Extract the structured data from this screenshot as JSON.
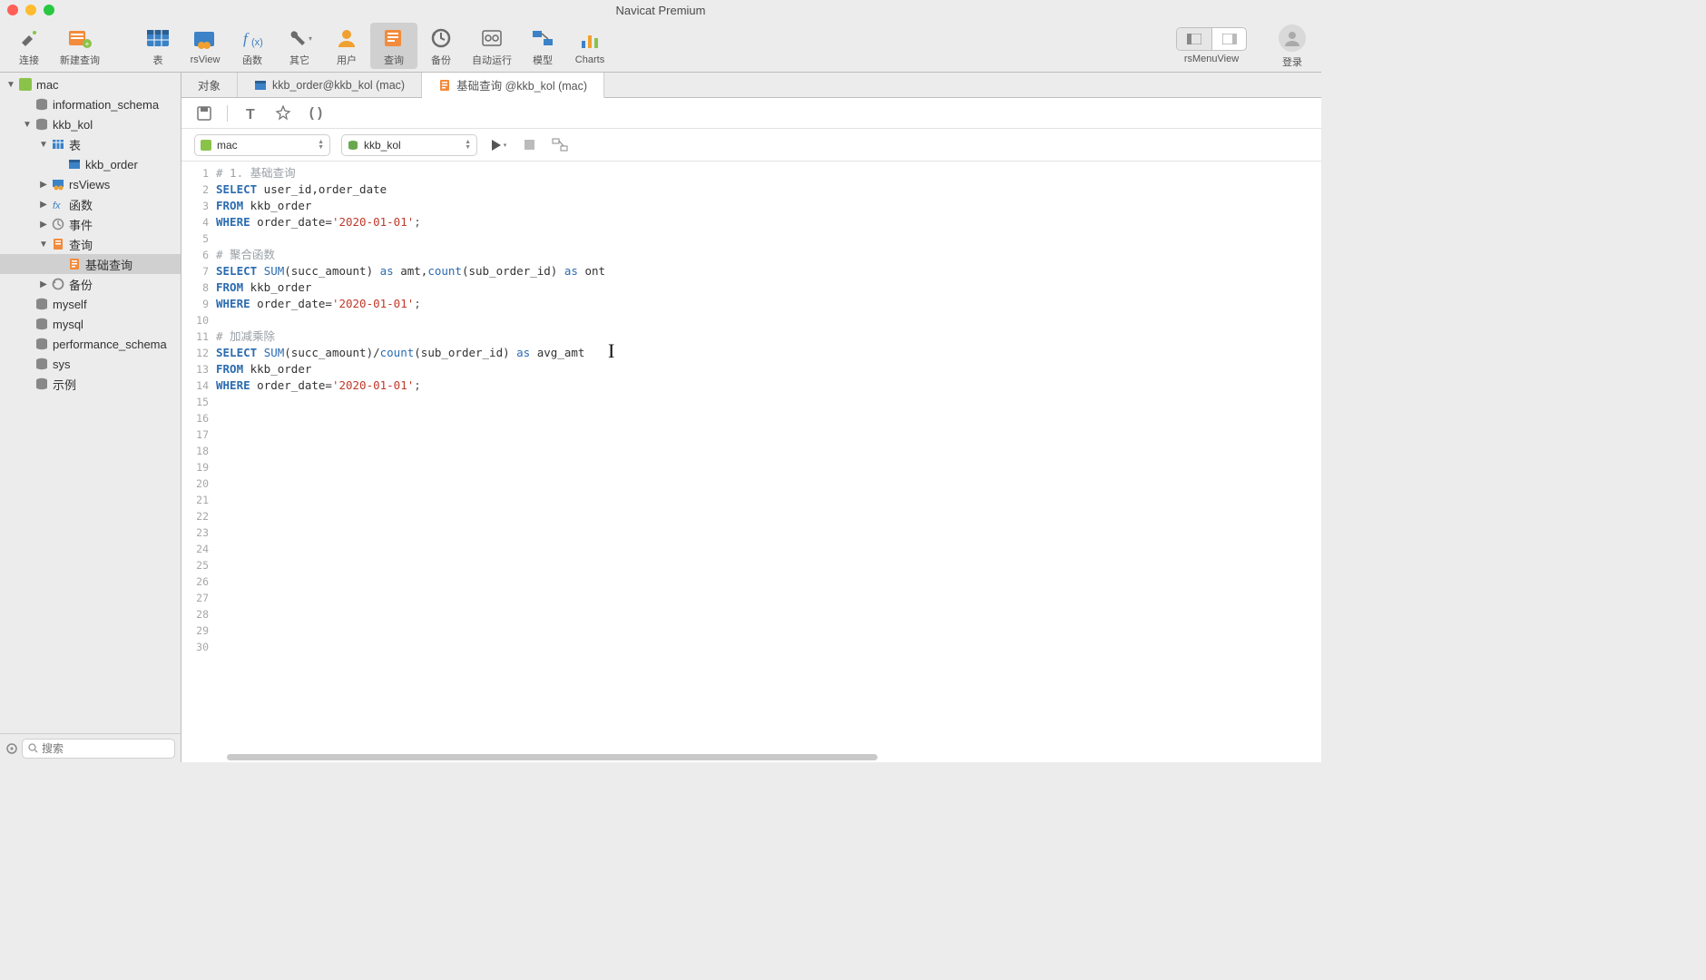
{
  "app": {
    "title": "Navicat Premium"
  },
  "toolbar": {
    "items": [
      {
        "label": "连接"
      },
      {
        "label": "新建查询"
      },
      {
        "label": "表"
      },
      {
        "label": "rsView"
      },
      {
        "label": "函数"
      },
      {
        "label": "其它"
      },
      {
        "label": "用户"
      },
      {
        "label": "查询"
      },
      {
        "label": "备份"
      },
      {
        "label": "自动运行"
      },
      {
        "label": "模型"
      },
      {
        "label": "Charts"
      }
    ],
    "right_text": "rsMenuView",
    "login_label": "登录"
  },
  "sidebar": {
    "search_placeholder": "搜索",
    "tree": [
      {
        "label": "mac",
        "depth": 0,
        "icon": "conn-green",
        "arrow": "down"
      },
      {
        "label": "information_schema",
        "depth": 1,
        "icon": "db"
      },
      {
        "label": "kkb_kol",
        "depth": 1,
        "icon": "db",
        "arrow": "down"
      },
      {
        "label": "表",
        "depth": 2,
        "icon": "table",
        "arrow": "down"
      },
      {
        "label": "kkb_order",
        "depth": 3,
        "icon": "table-blue"
      },
      {
        "label": "rsViews",
        "depth": 2,
        "icon": "view",
        "arrow": "right"
      },
      {
        "label": "函数",
        "depth": 2,
        "icon": "fx",
        "arrow": "right"
      },
      {
        "label": "事件",
        "depth": 2,
        "icon": "event",
        "arrow": "right"
      },
      {
        "label": "查询",
        "depth": 2,
        "icon": "query",
        "arrow": "down"
      },
      {
        "label": "基础查询",
        "depth": 3,
        "icon": "query-doc",
        "selected": true
      },
      {
        "label": "备份",
        "depth": 2,
        "icon": "backup",
        "arrow": "right"
      },
      {
        "label": "myself",
        "depth": 1,
        "icon": "db"
      },
      {
        "label": "mysql",
        "depth": 1,
        "icon": "db"
      },
      {
        "label": "performance_schema",
        "depth": 1,
        "icon": "db"
      },
      {
        "label": "sys",
        "depth": 1,
        "icon": "db"
      },
      {
        "label": "示例",
        "depth": 1,
        "icon": "db"
      }
    ]
  },
  "tabs": [
    {
      "label": "对象"
    },
    {
      "label": "kkb_order@kkb_kol (mac)",
      "icon": "table-blue"
    },
    {
      "label": "基础查询 @kkb_kol (mac)",
      "icon": "query-doc",
      "active": true
    }
  ],
  "run_row": {
    "connection": "mac",
    "database": "kkb_kol"
  },
  "code_lines": [
    {
      "type": "cmt",
      "raw": "# 1. 基础查询"
    },
    {
      "type": "sql",
      "t": [
        "SELECT",
        " user_id,order_date"
      ]
    },
    {
      "type": "sql",
      "t": [
        "FROM",
        " kkb_order"
      ]
    },
    {
      "type": "sql",
      "t": [
        "WHERE",
        " order_date=",
        "'2020-01-01'",
        ";"
      ]
    },
    {
      "type": "blank"
    },
    {
      "type": "cmt",
      "raw": "# 聚合函数"
    },
    {
      "type": "sql",
      "t": [
        "SELECT",
        " ",
        "SUM",
        "(succ_amount) ",
        "as",
        " amt,",
        "count",
        "(sub_order_id) ",
        "as",
        " ont"
      ]
    },
    {
      "type": "sql",
      "t": [
        "FROM",
        " kkb_order"
      ]
    },
    {
      "type": "sql",
      "t": [
        "WHERE",
        " order_date=",
        "'2020-01-01'",
        ";"
      ]
    },
    {
      "type": "blank"
    },
    {
      "type": "cmt",
      "raw": "# 加减乘除"
    },
    {
      "type": "sql",
      "t": [
        "SELECT",
        " ",
        "SUM",
        "(succ_amount)/",
        "count",
        "(sub_order_id) ",
        "as",
        " avg_amt"
      ]
    },
    {
      "type": "sql",
      "t": [
        "FROM",
        " kkb_order"
      ]
    },
    {
      "type": "sql",
      "t": [
        "WHERE",
        " order_date=",
        "'2020-01-01'",
        ";"
      ]
    }
  ],
  "line_count": 30
}
